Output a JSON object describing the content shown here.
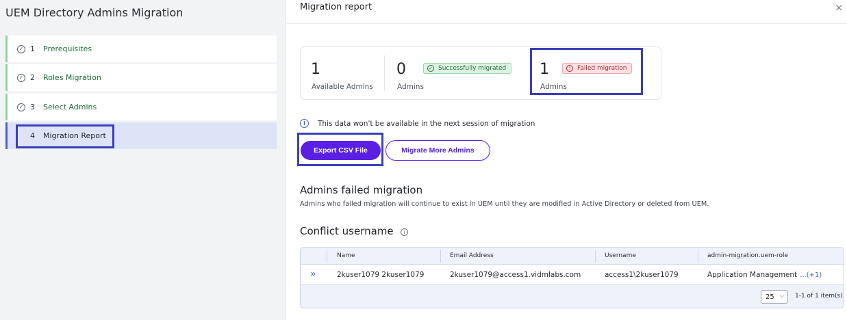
{
  "sidebar": {
    "title": "UEM Directory Admins Migration",
    "steps": [
      {
        "num": "1",
        "label": "Prerequisites"
      },
      {
        "num": "2",
        "label": "Roles Migration"
      },
      {
        "num": "3",
        "label": "Select Admins"
      },
      {
        "num": "4",
        "label": "Migration Report"
      }
    ]
  },
  "header": {
    "title": "Migration report",
    "close": "×"
  },
  "stats": {
    "available": {
      "value": "1",
      "label": "Available Admins"
    },
    "success": {
      "value": "0",
      "label": "Admins",
      "badge": "Successfully migrated"
    },
    "failed": {
      "value": "1",
      "label": "Admins",
      "badge": "Failed migration"
    }
  },
  "notice": "This data won't be available in the next session of migration",
  "actions": {
    "export": "Export CSV File",
    "migrate_more": "Migrate More Admins"
  },
  "failed_section": {
    "title": "Admins failed migration",
    "description": "Admins who failed migration will continue to exist in UEM until they are modified in Active Directory or deleted from UEM."
  },
  "conflict": {
    "title": "Conflict username",
    "columns": [
      "Name",
      "Email Address",
      "Username",
      "admin-migration.uem-role"
    ],
    "rows": [
      {
        "name": "2kuser1079 2kuser1079",
        "email": "2kuser1079@access1.vidmlabs.com",
        "username": "access1\\2kuser1079",
        "role": "Application Management",
        "more": "...(+1)"
      }
    ],
    "page_size": "25",
    "pager": "1-1 of 1 item(s)"
  },
  "colors": {
    "accent": "#5a1fe3",
    "highlight": "#3b3fb8",
    "success": "#256b3a",
    "fail": "#a82832"
  }
}
